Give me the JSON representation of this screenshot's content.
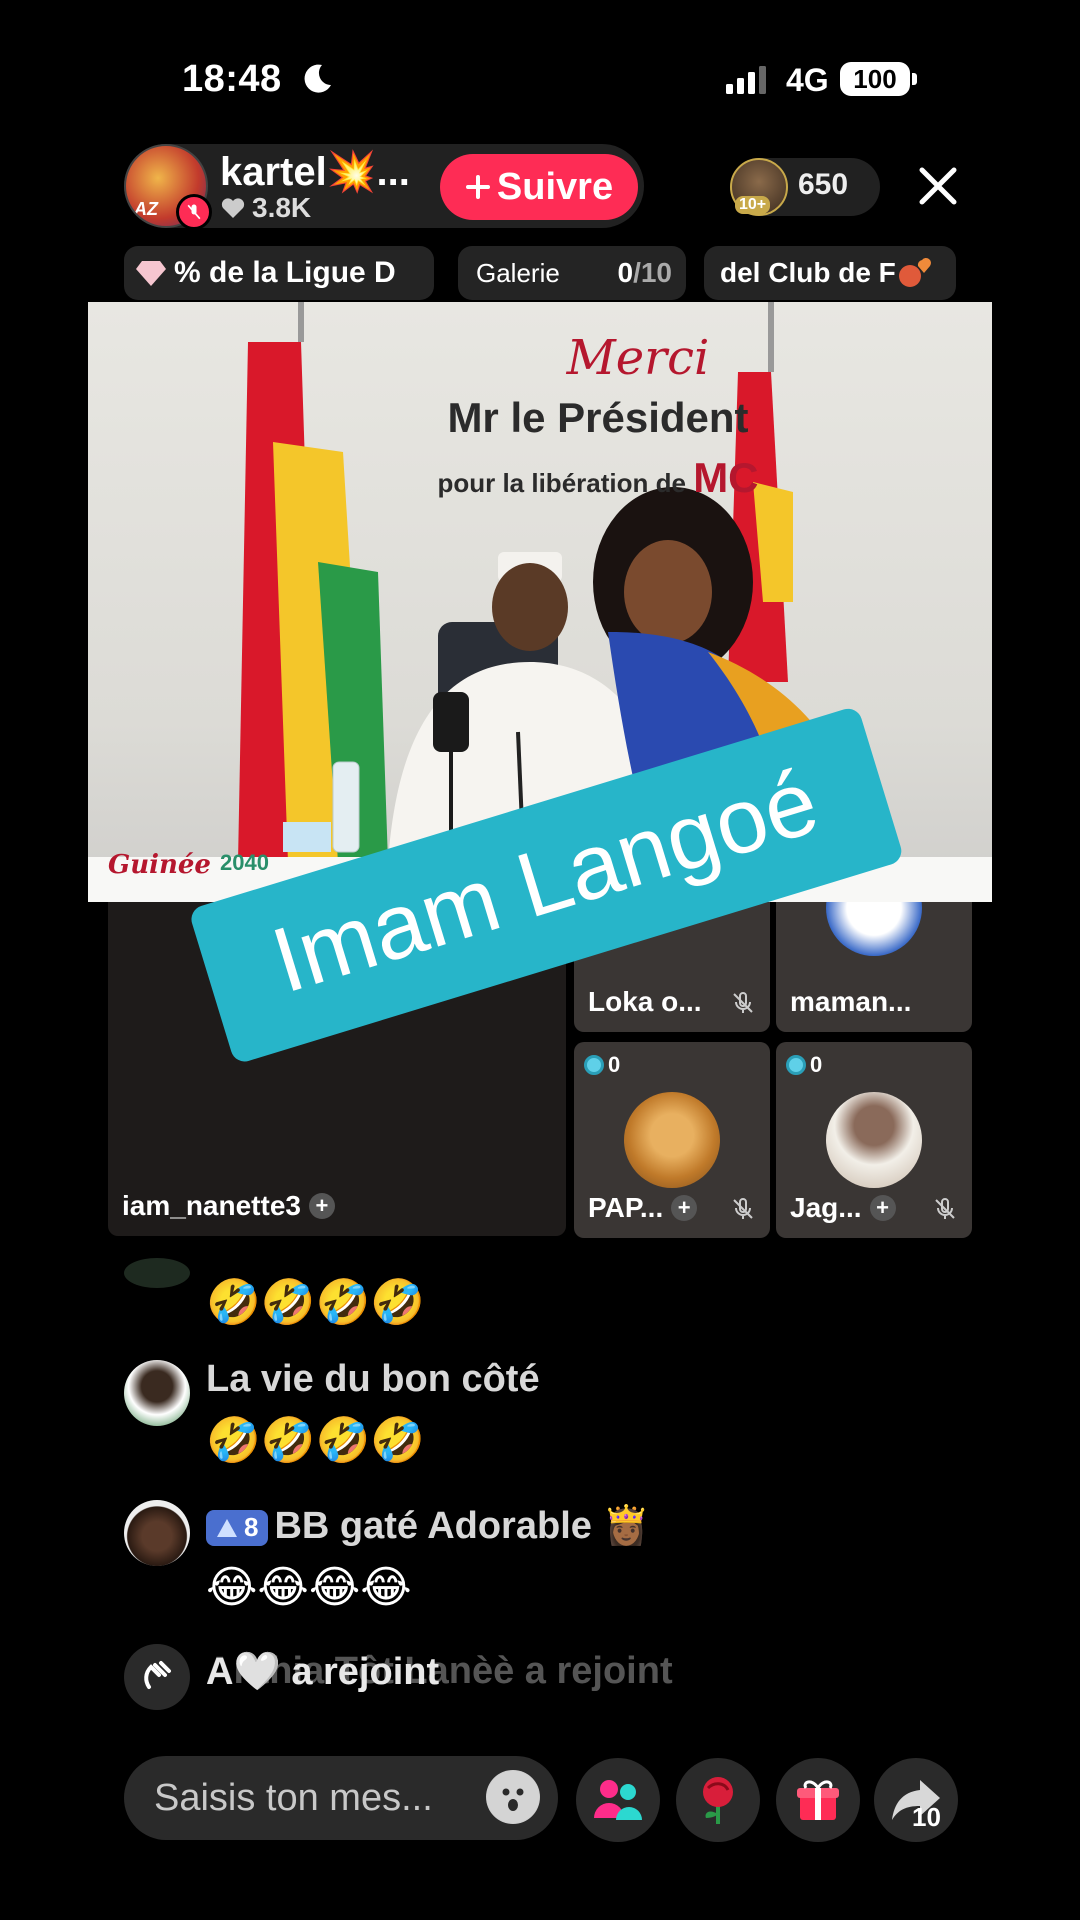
{
  "status_bar": {
    "time": "18:48",
    "network": "4G",
    "battery": "100"
  },
  "host": {
    "name": "kartel💥...",
    "likes": "3.8K",
    "follow_label": "Suivre"
  },
  "viewers": {
    "count": "650",
    "badge": "10+"
  },
  "chips": {
    "league": "% de la Ligue D",
    "gallery_label": "Galerie",
    "gallery_count": "0",
    "gallery_total": "/10",
    "club": "del Club de F"
  },
  "photo": {
    "merci": "Merci",
    "title": "Mr le Président",
    "subtitle": "pour la libération de",
    "subtitle_highlight": "MC",
    "logo_left": "Guinée",
    "logo_year": "2040"
  },
  "sticker": {
    "text": "Imam Langoé"
  },
  "grid": {
    "main": {
      "name": "iam_nanette3"
    },
    "tiles": [
      {
        "name": "Loka o...",
        "score": ""
      },
      {
        "name": "maman...",
        "score": ""
      },
      {
        "name": "PAP...",
        "score": "0"
      },
      {
        "name": "Jag...",
        "score": "0"
      }
    ]
  },
  "chat": [
    {
      "name": "",
      "message": "🤣🤣🤣🤣"
    },
    {
      "name": "La vie du bon côté",
      "message": "🤣🤣🤣🤣"
    },
    {
      "level": "8",
      "name": "BB gaté Adorable 👸🏾",
      "message": "😂😂😂😂"
    },
    {
      "name": "A🤍 a rejoint",
      "ghost": "Anthia Tôt Lanèè a rejoint"
    }
  ],
  "bottom": {
    "input_placeholder": "Saisis ton mes...",
    "share_count": "10"
  },
  "colors": {
    "accent": "#fe2c55",
    "sticker": "#27b5c9",
    "background": "#000000"
  }
}
